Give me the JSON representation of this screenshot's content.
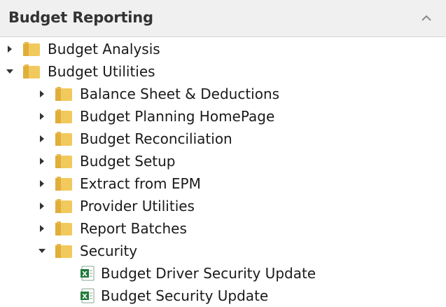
{
  "header": {
    "title": "Budget Reporting"
  },
  "tree": {
    "root_items": [
      {
        "label": "Budget Analysis",
        "expanded": false,
        "icon": "folder-icon"
      },
      {
        "label": "Budget Utilities",
        "expanded": true,
        "icon": "folder-icon",
        "children": [
          {
            "label": "Balance Sheet & Deductions",
            "expanded": false,
            "icon": "folder-icon"
          },
          {
            "label": "Budget Planning HomePage",
            "expanded": false,
            "icon": "folder-icon"
          },
          {
            "label": "Budget Reconciliation",
            "expanded": false,
            "icon": "folder-icon"
          },
          {
            "label": "Budget Setup",
            "expanded": false,
            "icon": "folder-icon"
          },
          {
            "label": "Extract from EPM",
            "expanded": false,
            "icon": "folder-icon"
          },
          {
            "label": "Provider Utilities",
            "expanded": false,
            "icon": "folder-icon"
          },
          {
            "label": "Report Batches",
            "expanded": false,
            "icon": "folder-icon"
          },
          {
            "label": "Security",
            "expanded": true,
            "icon": "folder-icon",
            "children": [
              {
                "label": "Budget Driver Security Update",
                "icon": "excel-file-icon"
              },
              {
                "label": "Budget Security Update",
                "icon": "excel-file-icon"
              }
            ]
          }
        ]
      }
    ]
  },
  "colors": {
    "folder": "#f2c95c",
    "folder_dark": "#d9a632",
    "excel": "#1f7a3a",
    "header_bg": "#f0f0f0"
  }
}
